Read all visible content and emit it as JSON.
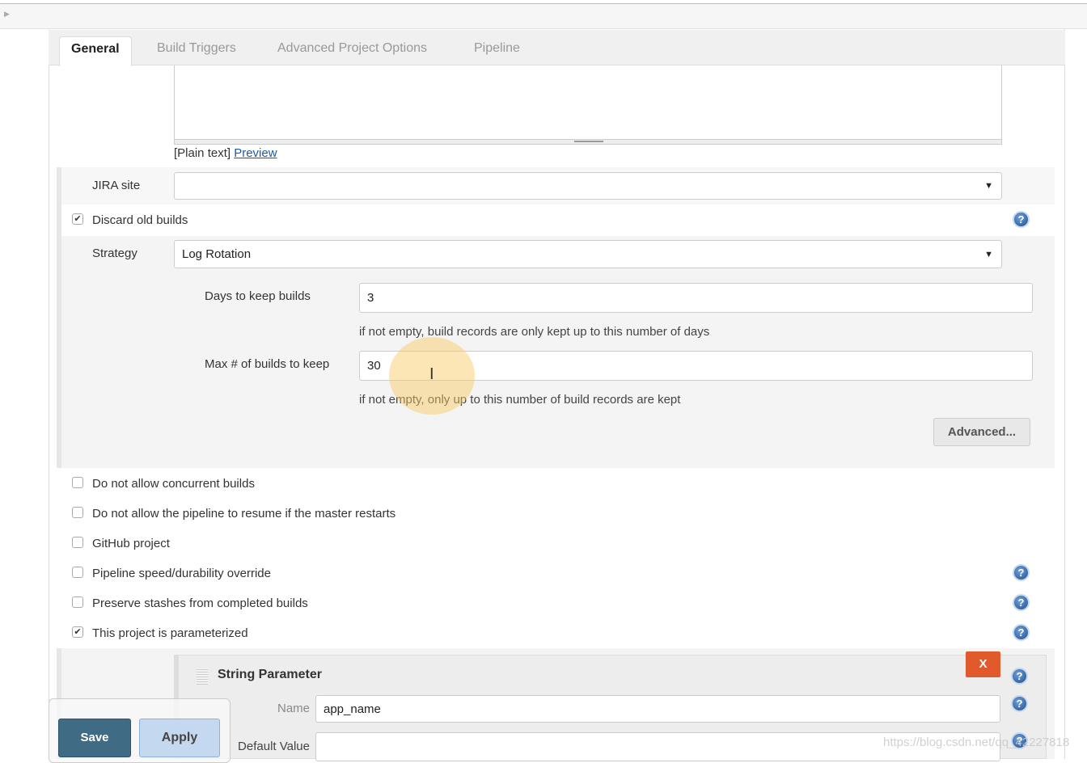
{
  "tabs": [
    {
      "label": "General"
    },
    {
      "label": "Build Triggers"
    },
    {
      "label": "Advanced Project Options"
    },
    {
      "label": "Pipeline"
    }
  ],
  "description": {
    "format": "[Plain text]",
    "preview": "Preview",
    "value": ""
  },
  "jira": {
    "label": "JIRA site",
    "value": ""
  },
  "discard": {
    "label": "Discard old builds",
    "checked": true,
    "strategy_label": "Strategy",
    "strategy_value": "Log Rotation",
    "days_label": "Days to keep builds",
    "days_value": "3",
    "days_hint": "if not empty, build records are only kept up to this number of days",
    "max_label": "Max # of builds to keep",
    "max_value": "30",
    "max_hint": "if not empty, only up to this number of build records are kept",
    "advanced": "Advanced..."
  },
  "options": [
    {
      "label": "Do not allow concurrent builds",
      "checked": false
    },
    {
      "label": "Do not allow the pipeline to resume if the master restarts",
      "checked": false
    },
    {
      "label": "GitHub project",
      "checked": false
    },
    {
      "label": "Pipeline speed/durability override",
      "checked": false
    },
    {
      "label": "Preserve stashes from completed builds",
      "checked": false
    },
    {
      "label": "This project is parameterized",
      "checked": true
    }
  ],
  "param": {
    "title": "String Parameter",
    "delete": "X",
    "name_label": "Name",
    "name_value": "app_name",
    "default_label": "Default Value",
    "default_value": ""
  },
  "buttons": {
    "save": "Save",
    "apply": "Apply"
  },
  "watermark": "https://blog.csdn.net/qq_42227818",
  "colors": {
    "save": "#3f6b85",
    "apply": "#c4d9ef",
    "delete": "#e05a2b",
    "link": "#1b5aa8"
  }
}
